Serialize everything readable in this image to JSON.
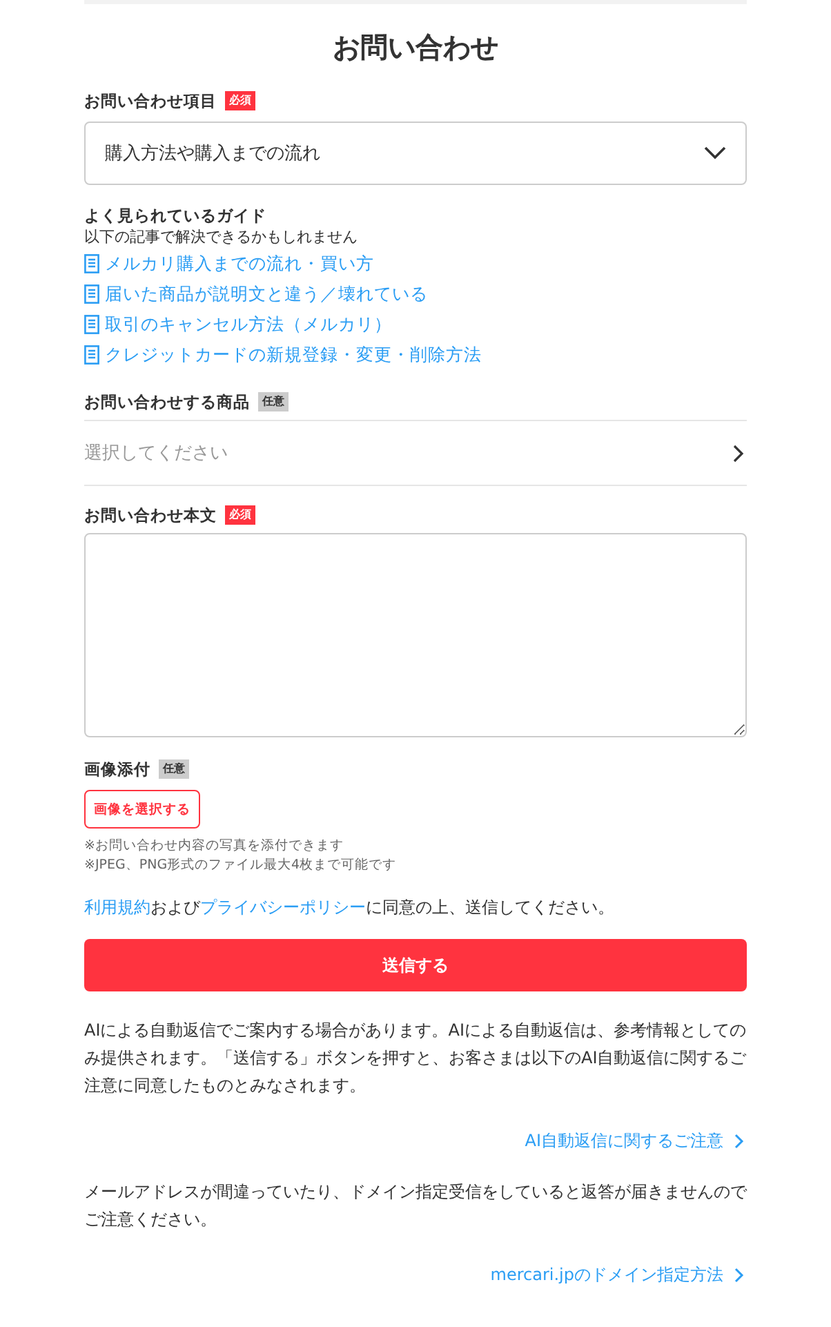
{
  "title": "お問い合わせ",
  "category": {
    "label": "お問い合わせ項目",
    "badge": {
      "kind": "required",
      "text": "必須"
    },
    "value": "購入方法や購入までの流れ"
  },
  "guide": {
    "heading": "よく見られているガイド",
    "subheading": "以下の記事で解決できるかもしれません",
    "links": [
      {
        "text": "メルカリ購入までの流れ・買い方"
      },
      {
        "text": "届いた商品が説明文と違う／壊れている"
      },
      {
        "text": "取引のキャンセル方法（メルカリ）"
      },
      {
        "text": "クレジットカードの新規登録・変更・削除方法"
      }
    ]
  },
  "product": {
    "label": "お問い合わせする商品",
    "badge": {
      "kind": "optional",
      "text": "任意"
    },
    "placeholder": "選択してください"
  },
  "body": {
    "label": "お問い合わせ本文",
    "badge": {
      "kind": "required",
      "text": "必須"
    }
  },
  "attachment": {
    "label": "画像添付",
    "badge": {
      "kind": "optional",
      "text": "任意"
    },
    "button": "画像を選択する",
    "notes": [
      "※お問い合わせ内容の写真を添付できます",
      "※JPEG、PNG形式のファイル最大4枚まで可能です"
    ]
  },
  "agreement": [
    {
      "kind": "link",
      "text": "利用規約"
    },
    {
      "kind": "text",
      "text": "および"
    },
    {
      "kind": "link",
      "text": "プライバシーポリシー"
    },
    {
      "kind": "text",
      "text": "に同意の上、送信してください。"
    }
  ],
  "submit": "送信する",
  "notices": [
    {
      "text": "AIによる自動返信でご案内する場合があります。AIによる自動返信は、参考情報としてのみ提供されます。「送信する」ボタンを押すと、お客さまは以下のAI自動返信に関するご注意に同意したものとみなされます。",
      "link": "AI自動返信に関するご注意"
    },
    {
      "text": "メールアドレスが間違っていたり、ドメイン指定受信をしていると返答が届きませんのでご注意ください。",
      "link": "mercari.jpのドメイン指定方法"
    }
  ]
}
